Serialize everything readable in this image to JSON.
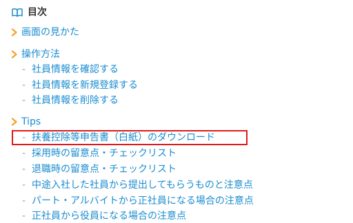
{
  "toc": {
    "title": "目次",
    "sections": [
      {
        "label": "画面の見かた",
        "items": []
      },
      {
        "label": "操作方法",
        "items": [
          "社員情報を確認する",
          "社員情報を新規登録する",
          "社員情報を削除する"
        ]
      },
      {
        "label": "Tips",
        "items": [
          "扶養控除等申告書（白紙）のダウンロード",
          "採用時の留意点・チェックリスト",
          "退職時の留意点・チェックリスト",
          "中途入社した社員から提出してもらうものと注意点",
          "パート・アルバイトから正社員になる場合の注意点",
          "正社員から役員になる場合の注意点"
        ]
      }
    ],
    "bullet": "-"
  },
  "colors": {
    "link": "#1a8ccf",
    "chevron": "#f0a030",
    "highlight": "#e01818"
  },
  "icons": {
    "header": "book-open-icon",
    "section": "chevron-right-icon"
  }
}
